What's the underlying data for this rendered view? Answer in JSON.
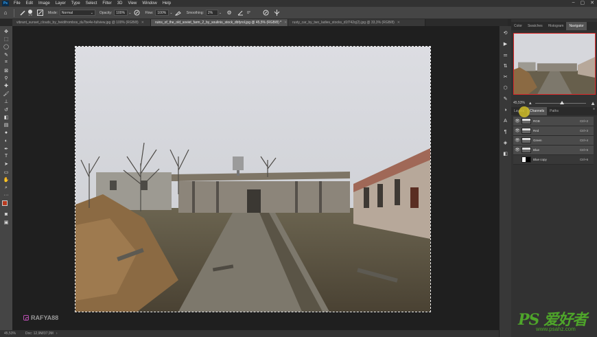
{
  "app": {
    "logo": "Ps"
  },
  "menu": [
    "File",
    "Edit",
    "Image",
    "Layer",
    "Type",
    "Select",
    "Filter",
    "3D",
    "View",
    "Window",
    "Help"
  ],
  "window_controls": [
    "–",
    "▢",
    "✕"
  ],
  "options": {
    "brush_size": "170",
    "mode_label": "Mode:",
    "mode_value": "Normal",
    "opacity_label": "Opacity:",
    "opacity_value": "100%",
    "flow_label": "Flow:",
    "flow_value": "100%",
    "smoothing_label": "Smoothing:",
    "smoothing_value": "2%",
    "angle_value": "0°"
  },
  "tabs": [
    {
      "label": "vibrant_sunset_clouds_by_heidifrombos_du7be4e-fullview.jpg @ 100% (RGB/8)",
      "active": false
    },
    {
      "label": "ruins_of_the_old_soviet_farm_2_by_soulinis_stock_dbfyrol.jpg @ 45,5% (RGB/8) *",
      "active": true
    },
    {
      "label": "rusty_car_by_two_ladies_stocks_d1f742q(2).jpg @ 33,3% (RGB/8)",
      "active": false
    }
  ],
  "tools": [
    "move-icon",
    "marquee-icon",
    "lasso-icon",
    "quick-select-icon",
    "crop-icon",
    "frame-icon",
    "eyedropper-icon",
    "healing-icon",
    "brush-icon",
    "stamp-icon",
    "history-brush-icon",
    "eraser-icon",
    "gradient-icon",
    "blur-icon",
    "dodge-icon",
    "pen-icon",
    "type-icon",
    "path-select-icon",
    "shape-icon",
    "hand-icon",
    "zoom-icon",
    "more-icon"
  ],
  "watermark": {
    "text": "RAFYA88"
  },
  "status": {
    "zoom": "45,53%",
    "doc": "Doc: 12,9M/37,9M"
  },
  "panel": {
    "top_tabs": [
      {
        "label": "Color",
        "active": false
      },
      {
        "label": "Swatches",
        "active": false
      },
      {
        "label": "Histogram",
        "active": false
      },
      {
        "label": "Navigator",
        "active": true
      }
    ],
    "zoom_value": "45,53%",
    "channel_tabs": [
      {
        "label": "Layers",
        "active": false
      },
      {
        "label": "Channels",
        "active": true
      },
      {
        "label": "Paths",
        "active": false
      }
    ],
    "channels": [
      {
        "name": "RGB",
        "shortcut": "Ctrl+2",
        "thumb": "rgb",
        "visible": true
      },
      {
        "name": "Red",
        "shortcut": "Ctrl+3",
        "thumb": "rgb",
        "visible": true
      },
      {
        "name": "Green",
        "shortcut": "Ctrl+4",
        "thumb": "rgb",
        "visible": true
      },
      {
        "name": "Blue",
        "shortcut": "Ctrl+5",
        "thumb": "rgb",
        "visible": true
      },
      {
        "name": "Blue copy",
        "shortcut": "Ctrl+6",
        "thumb": "white",
        "visible": false
      }
    ]
  },
  "site_mark": {
    "big": "PS 爱好者",
    "small": "www.psahz.com"
  },
  "colors": {
    "foreground": "#b83a1f",
    "background": "#111111",
    "navigator_frame": "#e0292a",
    "site_green": "#4ea52a"
  }
}
